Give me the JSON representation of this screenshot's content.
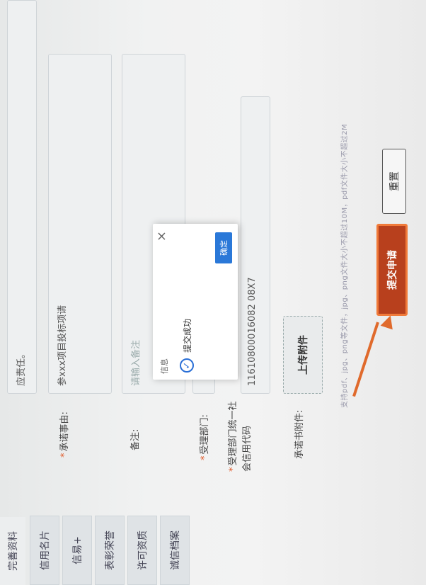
{
  "left_nav": [
    "完善资料",
    "信用名片",
    "信易+",
    "表彰荣誉",
    "许可资质",
    "诚信档案"
  ],
  "top_text": "应责任。",
  "form": {
    "matter_label": "承诺事由:",
    "matter_value": "参xxx项目投标项请",
    "remark_label": "备注:",
    "remark_placeholder": "请输入备注",
    "dept_label": "受理部门:",
    "credit_code_label": "受理部门统一社会信用代码",
    "credit_code_value": "11610800016082 08X7",
    "attach_label": "承诺书附件:",
    "upload_button": "上传附件",
    "attach_hint": "支持pdf、jpg、png等文件，jpg、png文件大小不超过10M，pdf文件大小不超过2M"
  },
  "buttons": {
    "submit": "提交申请",
    "reset": "重置"
  },
  "modal": {
    "title": "信息",
    "message": "提交成功",
    "ok": "确定",
    "close": "×"
  },
  "colors": {
    "accent": "#2a78d8",
    "submit": "#b8401d",
    "highlight": "#f07a3a"
  }
}
